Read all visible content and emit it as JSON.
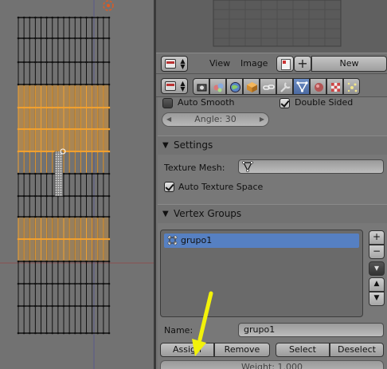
{
  "header": {
    "menu_view": "View",
    "menu_image": "Image",
    "new_label": "New"
  },
  "context_tabs": [
    {
      "icon": "render-icon"
    },
    {
      "icon": "scene-icon"
    },
    {
      "icon": "world-icon"
    },
    {
      "icon": "object-icon"
    },
    {
      "icon": "constraints-icon"
    },
    {
      "icon": "modifiers-icon"
    },
    {
      "icon": "mesh-data-icon",
      "active": true
    },
    {
      "icon": "material-icon"
    },
    {
      "icon": "texture-icon"
    },
    {
      "icon": "particles-icon"
    }
  ],
  "normals": {
    "auto_smooth_label": "Auto Smooth",
    "auto_smooth_checked": false,
    "double_sided_label": "Double Sided",
    "double_sided_checked": true,
    "angle_label": "Angle: 30"
  },
  "settings": {
    "title": "Settings",
    "texture_mesh_label": "Texture Mesh:",
    "texture_mesh_value": "",
    "auto_texture_space_label": "Auto Texture Space",
    "auto_texture_space_checked": true
  },
  "vertex_groups": {
    "title": "Vertex Groups",
    "items": [
      "grupo1"
    ],
    "name_label": "Name:",
    "name_value": "grupo1",
    "assign_label": "Assign",
    "remove_label": "Remove",
    "select_label": "Select",
    "deselect_label": "Deselect",
    "weight_label": "Weight: 1.000"
  },
  "colors": {
    "selection_orange": "#f0a030",
    "active_blue": "#5680c2",
    "annotation_arrow": "#f2f20a",
    "background": "#727272"
  }
}
